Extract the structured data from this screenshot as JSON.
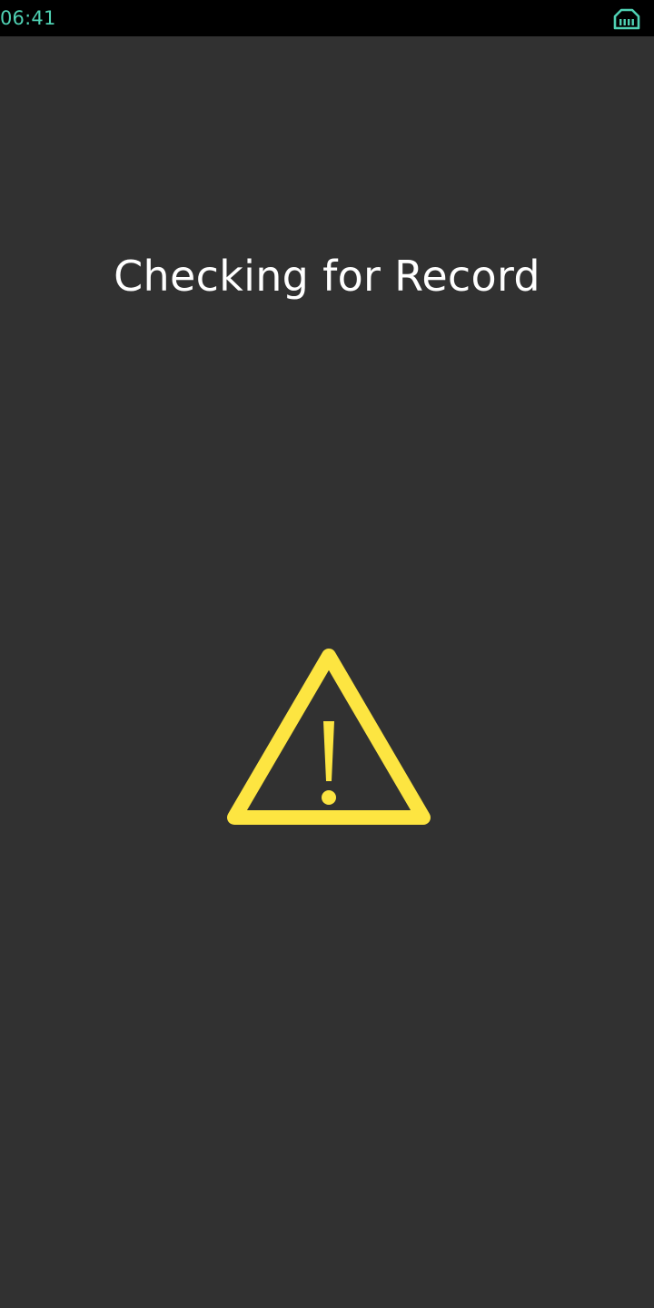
{
  "status_bar": {
    "time": "06:41",
    "network_icon": "ethernet-icon",
    "time_color": "#4fd1b3",
    "background": "#000000"
  },
  "screen": {
    "title": "Checking for Record",
    "icon": "warning-icon",
    "icon_color": "#fde541",
    "background": "#313131"
  }
}
